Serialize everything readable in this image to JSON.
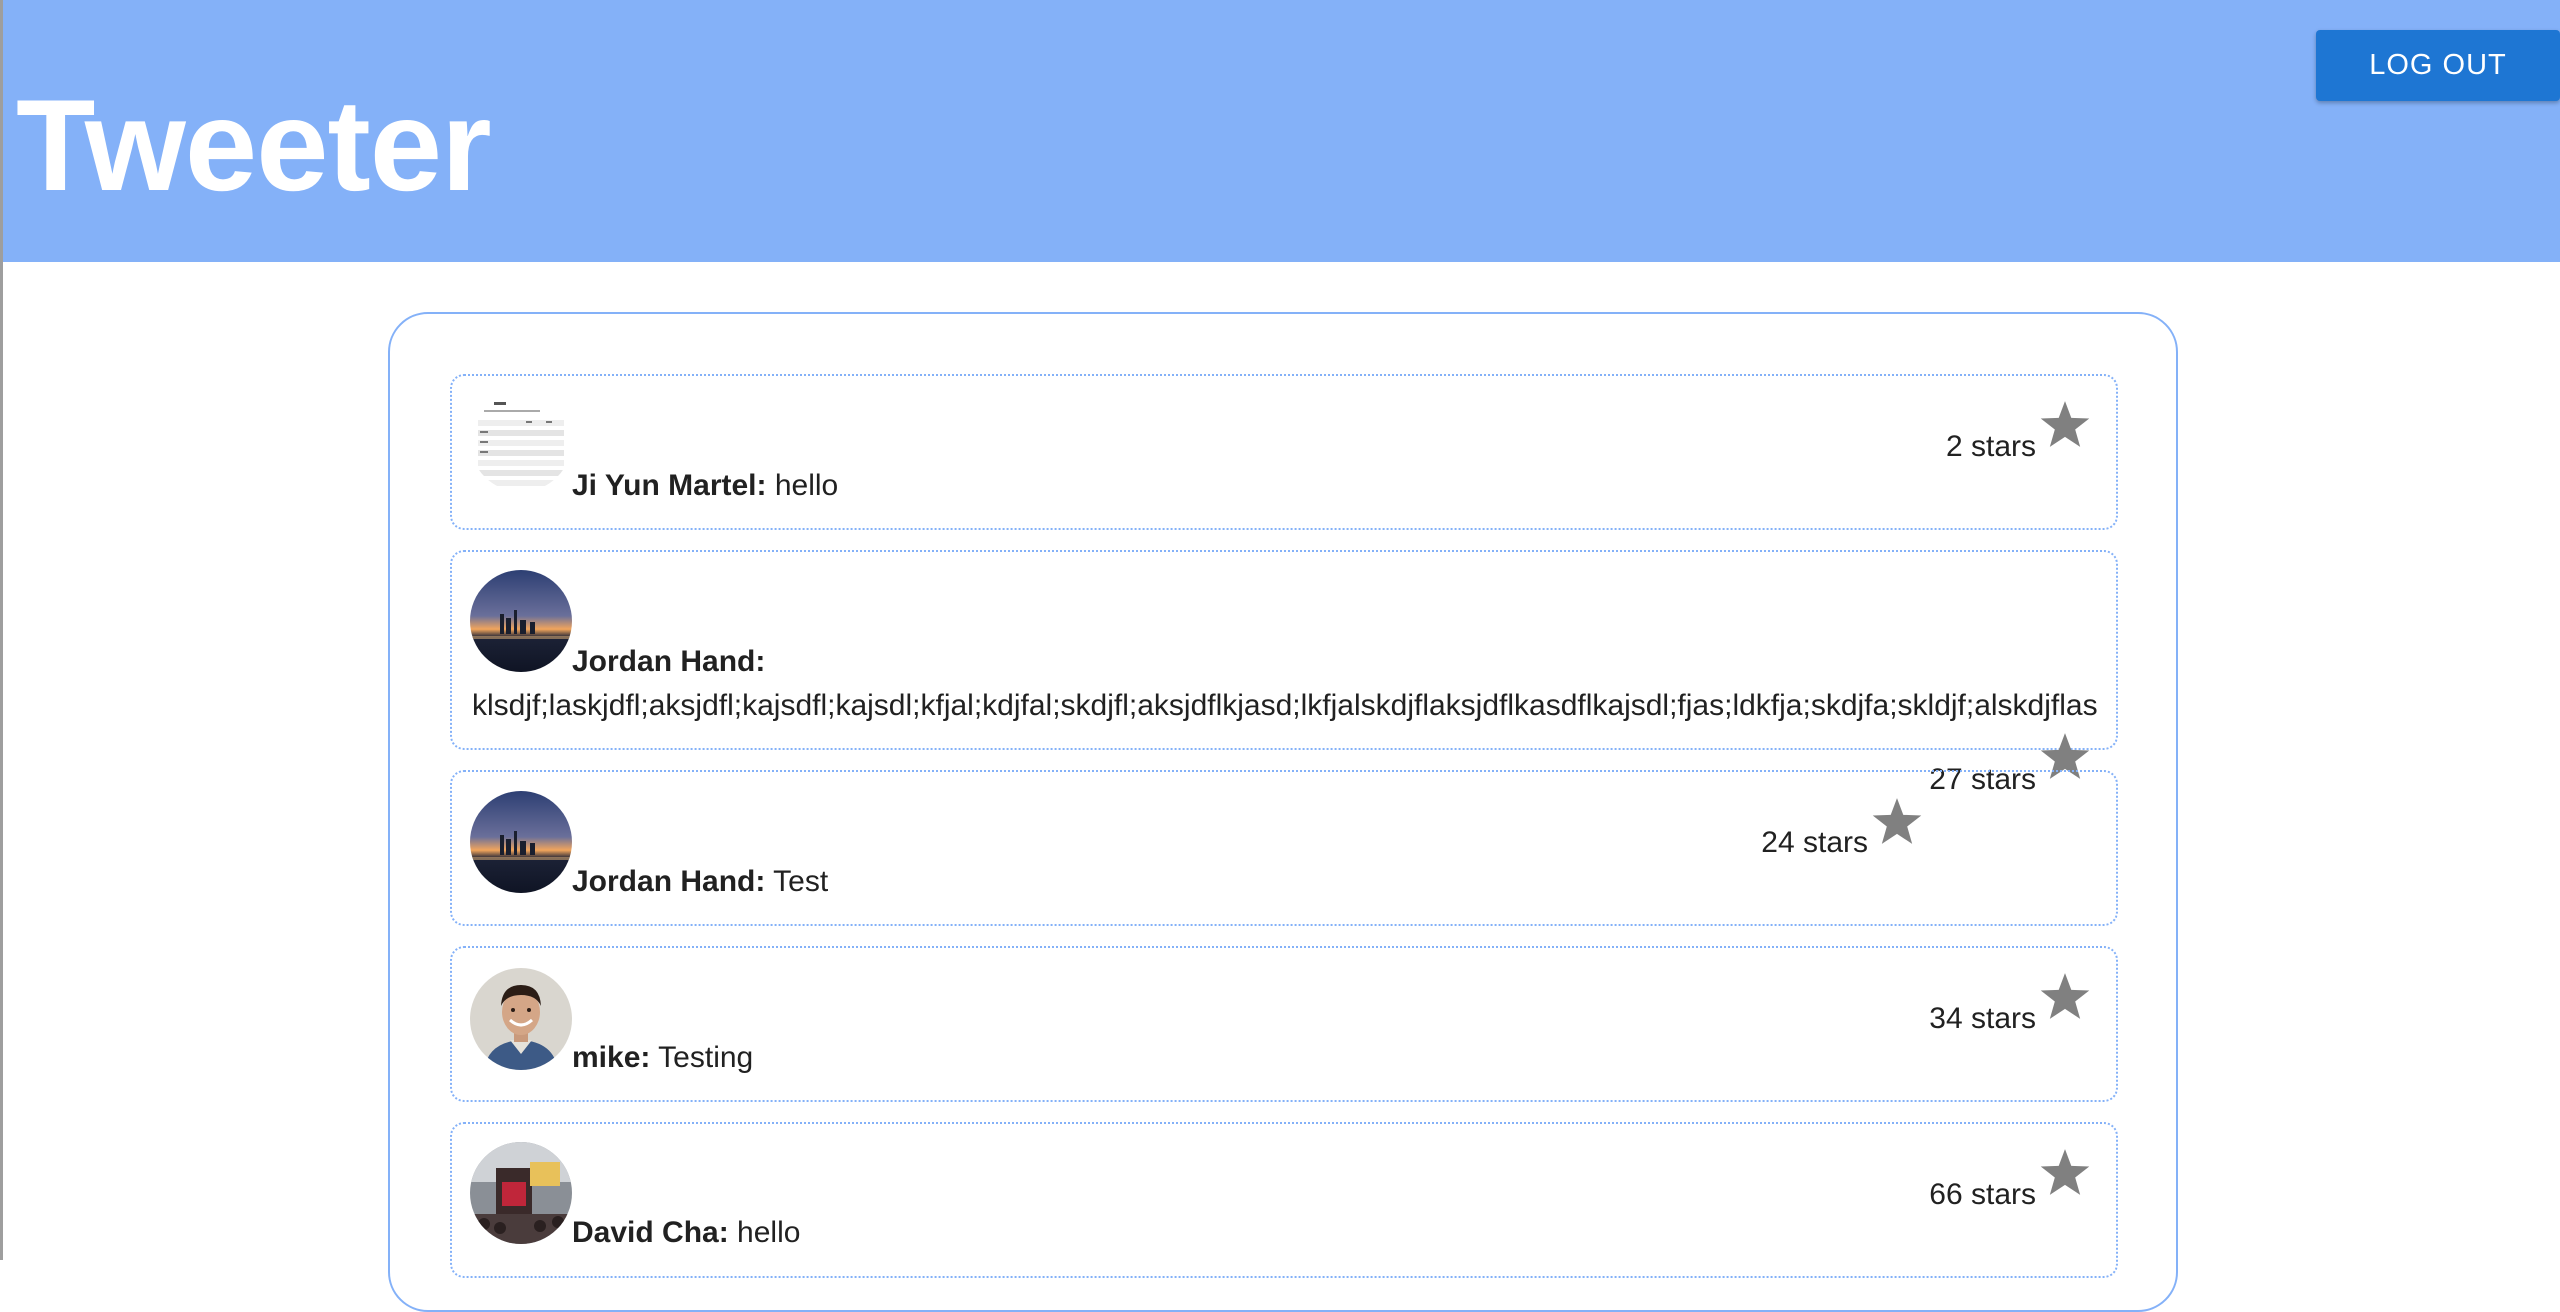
{
  "header": {
    "title": "Tweeter",
    "logout_label": "LOG OUT",
    "background_color": "#84b1f8",
    "button_color": "#1e76d3"
  },
  "tweets": [
    {
      "author": "Ji Yun Martel:",
      "text": "hello",
      "stars": "2 stars",
      "avatar": "spreadsheet-thumbnail"
    },
    {
      "author": "Jordan Hand:",
      "text": "klsdjf;laskjdfl;aksjdfl;kajsdfl;kajsdl;kfjal;kdjfal;skdjfl;aksjdflkjasd;lkfjalskdjflaksjdflkasdflkajsdl;fjas;ldkfja;skdjfa;skldjf;alskdjflas",
      "stars": "27 stars",
      "avatar": "city-skyline-photo"
    },
    {
      "author": "Jordan Hand:",
      "text": "Test",
      "stars": "24 stars",
      "avatar": "city-skyline-photo"
    },
    {
      "author": "mike:",
      "text": "Testing",
      "stars": "34 stars",
      "avatar": "portrait-photo"
    },
    {
      "author": "David Cha:",
      "text": "hello",
      "stars": "66 stars",
      "avatar": "concert-photo"
    }
  ],
  "icons": {
    "star": "star-icon",
    "star_color": "#808080"
  }
}
